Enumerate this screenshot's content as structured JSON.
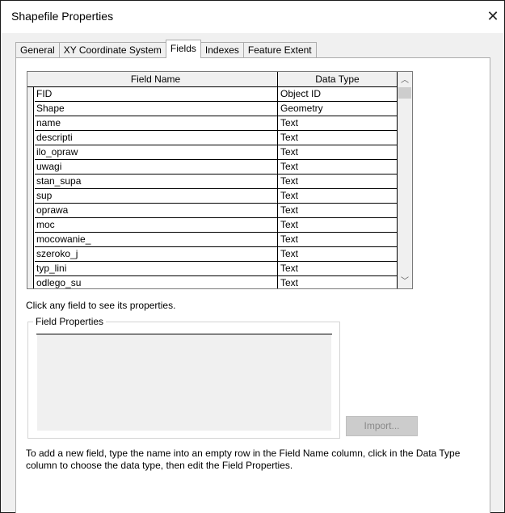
{
  "window": {
    "title": "Shapefile Properties",
    "close_glyph": "✕"
  },
  "tabs": [
    {
      "label": "General",
      "active": false
    },
    {
      "label": "XY Coordinate System",
      "active": false
    },
    {
      "label": "Fields",
      "active": true
    },
    {
      "label": "Indexes",
      "active": false
    },
    {
      "label": "Feature Extent",
      "active": false
    }
  ],
  "grid": {
    "headers": {
      "name": "Field Name",
      "type": "Data Type"
    },
    "rows": [
      {
        "name": "FID",
        "type": "Object ID"
      },
      {
        "name": "Shape",
        "type": "Geometry"
      },
      {
        "name": "name",
        "type": "Text"
      },
      {
        "name": "descripti",
        "type": "Text"
      },
      {
        "name": "ilo_opraw",
        "type": "Text"
      },
      {
        "name": "uwagi",
        "type": "Text"
      },
      {
        "name": "stan_supa",
        "type": "Text"
      },
      {
        "name": "sup",
        "type": "Text"
      },
      {
        "name": "oprawa",
        "type": "Text"
      },
      {
        "name": "moc",
        "type": "Text"
      },
      {
        "name": "mocowanie_",
        "type": "Text"
      },
      {
        "name": "szeroko_j",
        "type": "Text"
      },
      {
        "name": "typ_lini",
        "type": "Text"
      },
      {
        "name": "odlego_su",
        "type": "Text"
      }
    ]
  },
  "hint_text": "Click any field to see its properties.",
  "field_properties": {
    "legend": "Field Properties"
  },
  "import_button": {
    "label": "Import..."
  },
  "help_text": "To add a new field, type the name into an empty row in the Field Name column, click in the Data Type column to choose the data type, then edit the Field Properties."
}
